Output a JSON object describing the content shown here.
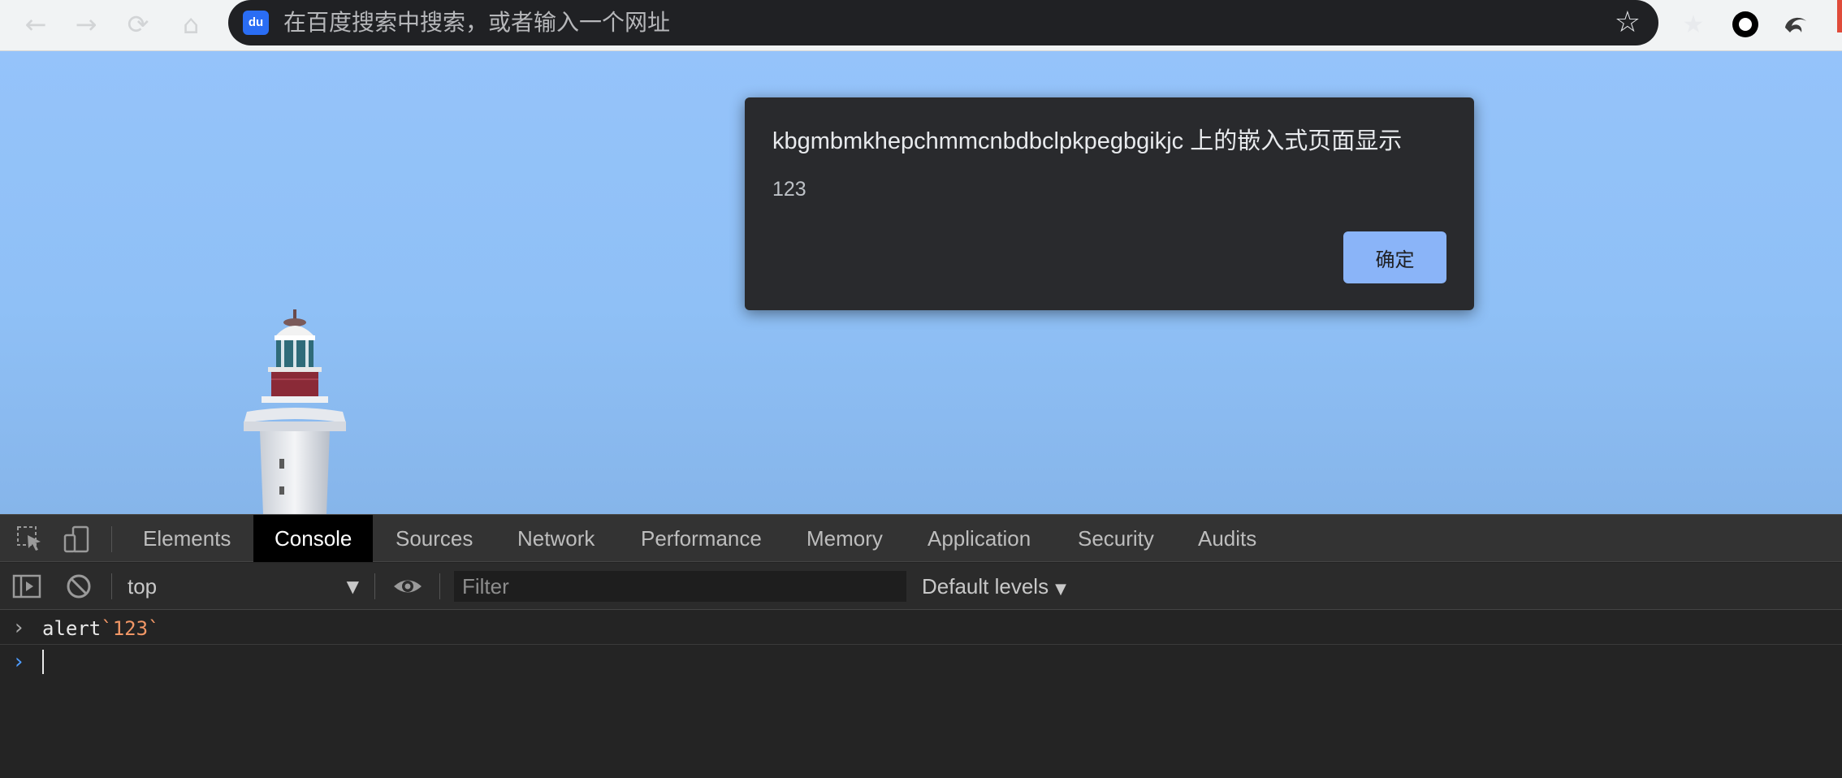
{
  "browser": {
    "omnibox_placeholder": "在百度搜索中搜索，或者输入一个网址",
    "omnibox_logo": "du",
    "nav_icons": [
      "back-arrow-icon",
      "forward-arrow-icon",
      "reload-icon",
      "home-icon"
    ],
    "extension_icons": [
      "bookmark-star-icon",
      "record-circle-icon",
      "swirl-extension-icon"
    ]
  },
  "dialog": {
    "title": "kbgmbmkhepchmmcnbdbclpkpegbgikjc 上的嵌入式页面显示",
    "message": "123",
    "ok_label": "确定"
  },
  "devtools": {
    "tabs": [
      {
        "label": "Elements",
        "active": false
      },
      {
        "label": "Console",
        "active": true
      },
      {
        "label": "Sources",
        "active": false
      },
      {
        "label": "Network",
        "active": false
      },
      {
        "label": "Performance",
        "active": false
      },
      {
        "label": "Memory",
        "active": false
      },
      {
        "label": "Application",
        "active": false
      },
      {
        "label": "Security",
        "active": false
      },
      {
        "label": "Audits",
        "active": false
      }
    ],
    "context": "top",
    "filter_placeholder": "Filter",
    "levels_label": "Default levels"
  },
  "console": {
    "input_fn": "alert",
    "input_string": "`123`"
  },
  "colors": {
    "sky": "#95c3fa",
    "dialog_bg": "#292a2d",
    "ok_button": "#8ab4f8",
    "prompt_chevron": "#4e9cff",
    "string_token": "#f29766"
  }
}
